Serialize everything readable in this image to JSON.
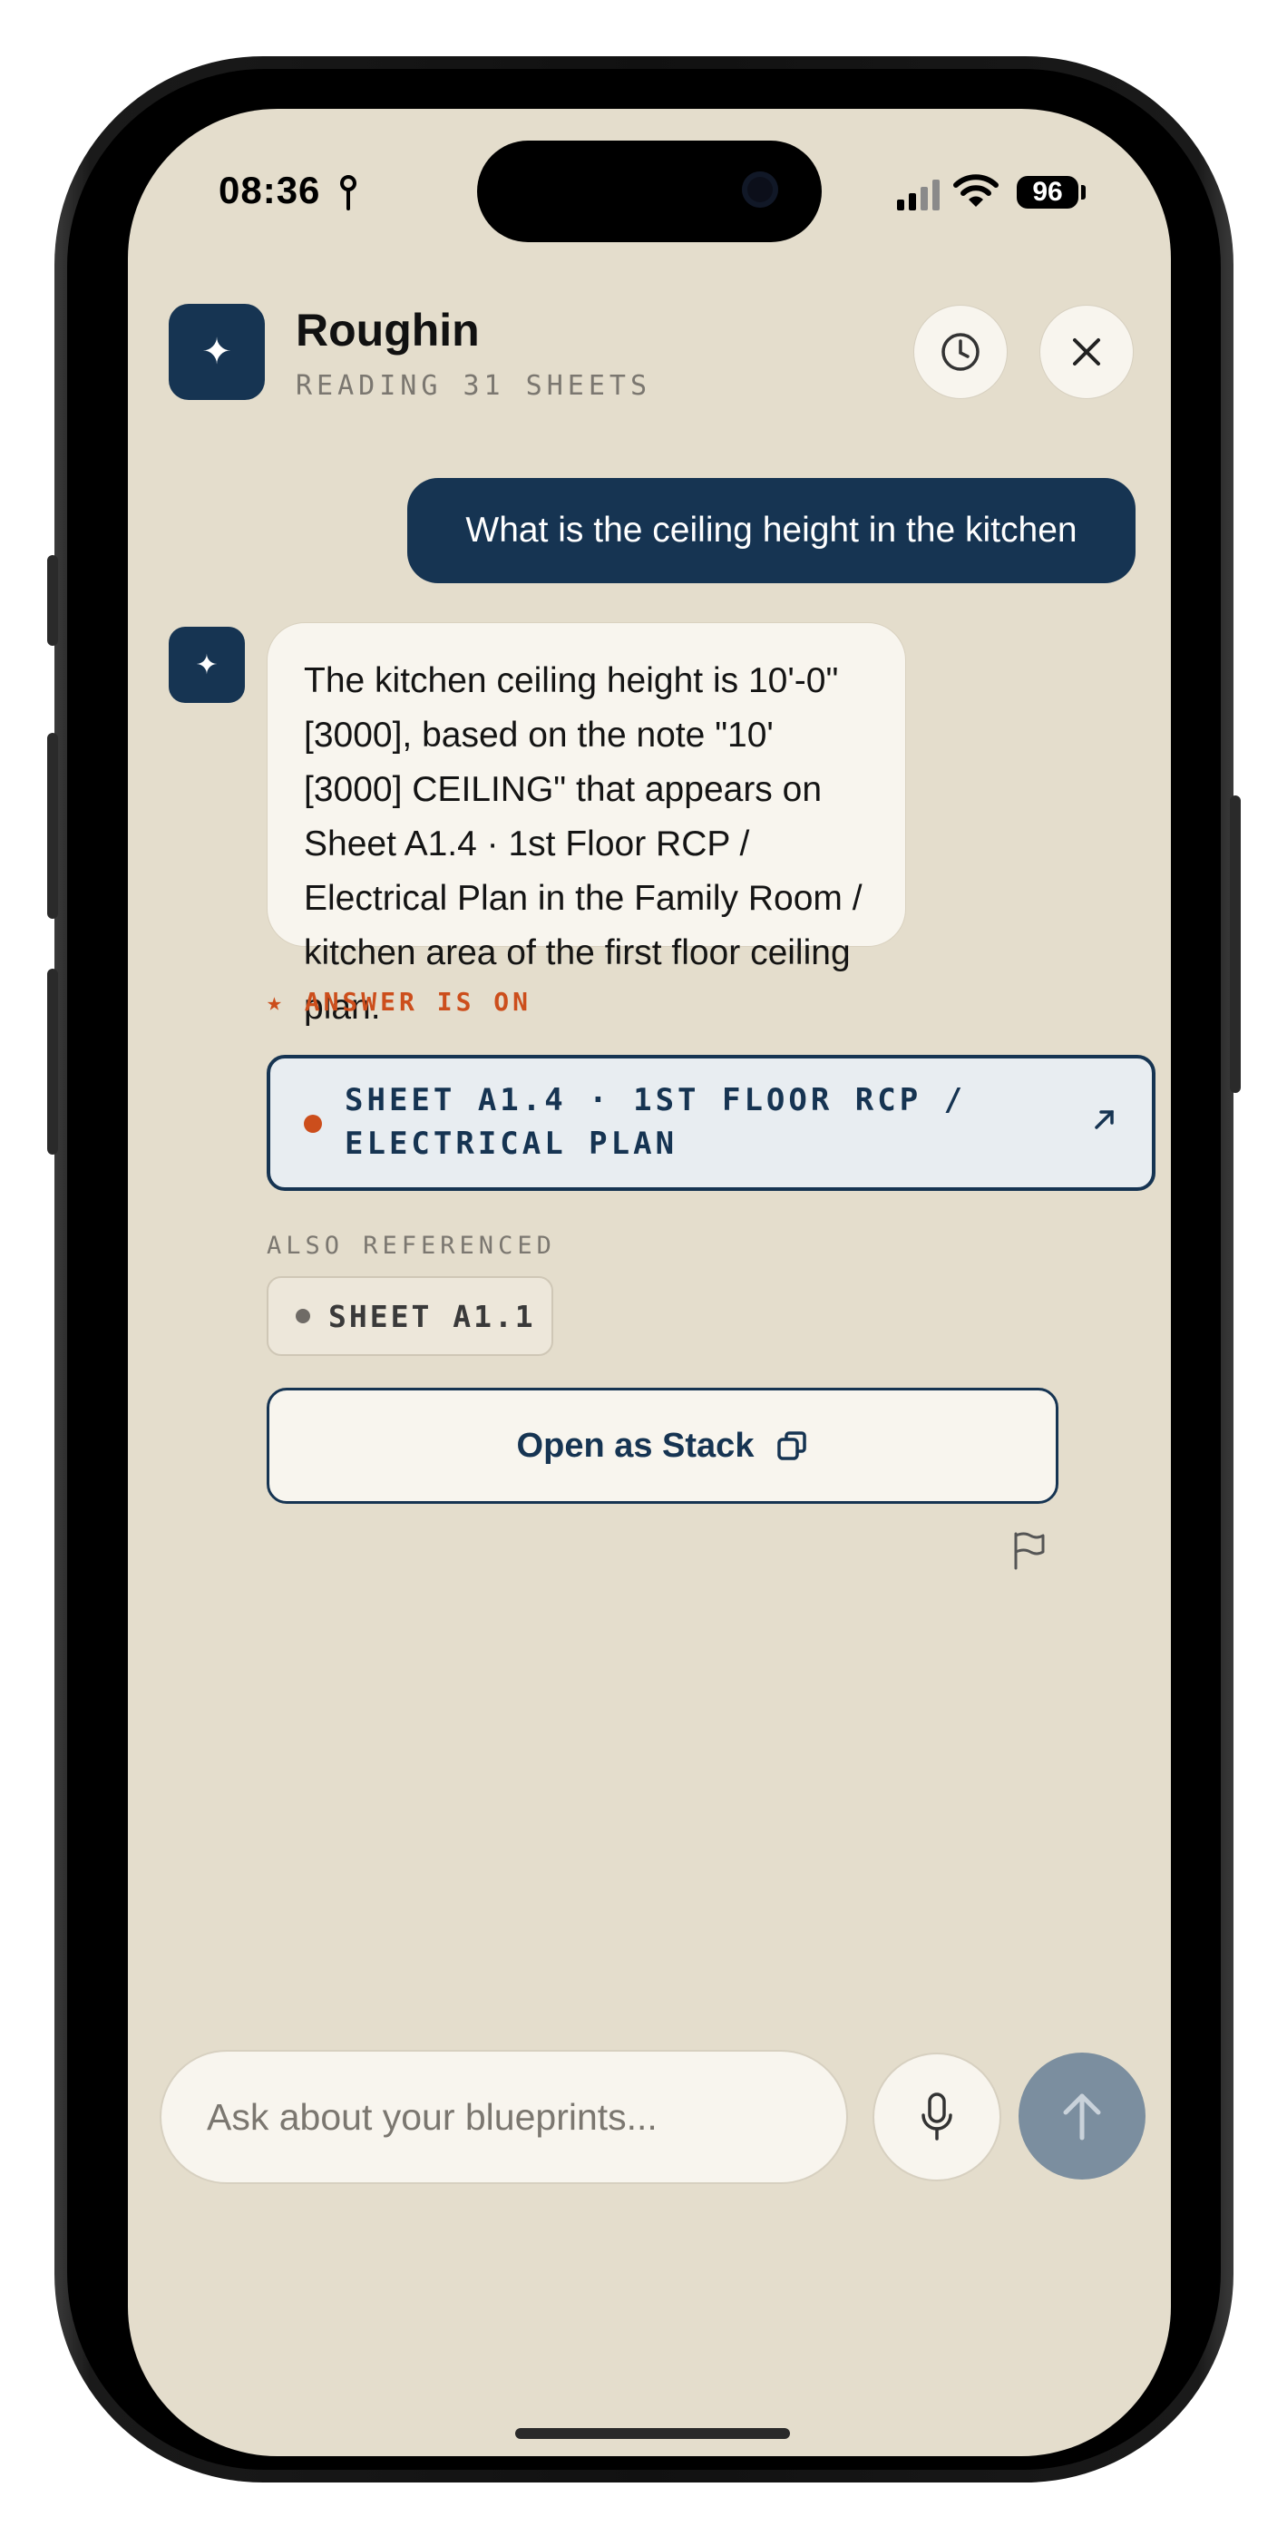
{
  "status_bar": {
    "time": "08:36",
    "battery": "96",
    "icons": [
      "location-arrow-icon",
      "signal-icon",
      "wifi-icon",
      "battery-icon"
    ]
  },
  "header": {
    "app_icon": "sparkle-icon",
    "title": "Roughin",
    "subtitle": "READING 31 SHEETS",
    "actions": [
      "history-icon",
      "close-icon"
    ]
  },
  "conversation": {
    "user_message": "What is the ceiling height in the kitchen",
    "bot_avatar_icon": "sparkle-icon",
    "bot_message": "The kitchen ceiling height is 10'-0\" [3000], based on the note \"10' [3000] CEILING\" that appears on Sheet A1.4 · 1st Floor RCP / Electrical Plan in the Family Room / kitchen area of the first floor ceiling plan."
  },
  "answer": {
    "label": "★ ANSWER IS ON",
    "sheet": "SHEET A1.4 · 1ST FLOOR RCP / ELECTRICAL PLAN",
    "open_icon": "arrow-up-right-icon",
    "also_label": "ALSO REFERENCED",
    "also_sheets": [
      "SHEET A1.1"
    ],
    "open_stack_label": "Open as Stack",
    "open_stack_icon": "copy-icon",
    "flag_icon": "flag-icon"
  },
  "composer": {
    "placeholder": "Ask about your blueprints...",
    "mic_icon": "microphone-icon",
    "send_icon": "arrow-up-icon"
  },
  "colors": {
    "background": "#e4ddcc",
    "navy": "#163452",
    "accent": "#cc4e1c",
    "card": "#f8f5ee",
    "send_disabled": "#7b8e9f"
  }
}
